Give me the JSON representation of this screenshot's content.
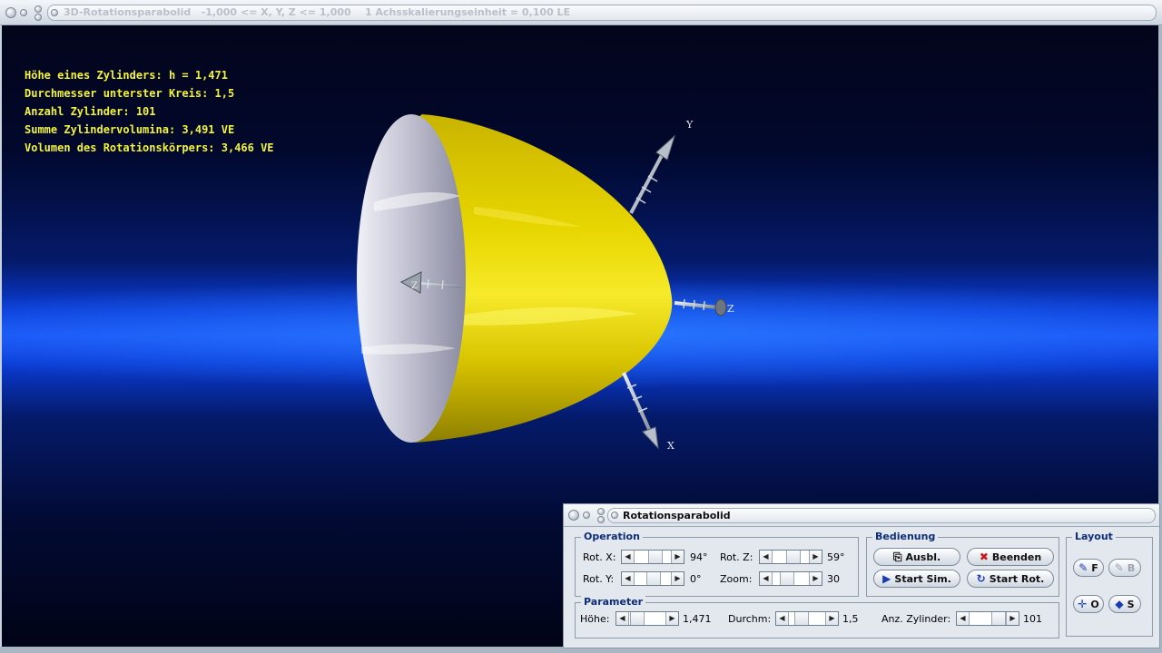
{
  "window": {
    "title": "3D-Rotationsparabolid   -1,000 <= X, Y, Z <= 1,000    1 Achsskalierungseinheit = 0,100 LE"
  },
  "info": {
    "lines": [
      "Höhe eines Zylinders: h = 1,471",
      "Durchmesser unterster Kreis: 1,5",
      "Anzahl Zylinder: 101",
      "Summe Zylindervolumina: 3,491 VE",
      "Volumen des Rotationskörpers: 3,466 VE"
    ]
  },
  "axes": {
    "x": "X",
    "y": "Y",
    "z": "Z",
    "z_back": "Z"
  },
  "colors": {
    "paraboloid": "#e6d200",
    "inner_surface": "#c8c8d8",
    "info_text": "#f2f23a",
    "group_label": "#0d2c7a"
  },
  "dialog": {
    "title": "Rotationsparabolid",
    "operation": {
      "label": "Operation",
      "rot_x_label": "Rot. X:",
      "rot_x_value": "94°",
      "rot_y_label": "Rot. Y:",
      "rot_y_value": "0°",
      "rot_z_label": "Rot. Z:",
      "rot_z_value": "59°",
      "zoom_label": "Zoom:",
      "zoom_value": "30"
    },
    "bedienung": {
      "label": "Bedienung",
      "ausbl": "Ausbl.",
      "beenden": "Beenden",
      "start_sim": "Start Sim.",
      "start_rot": "Start Rot."
    },
    "layout": {
      "label": "Layout",
      "f": "F",
      "b": "B",
      "o": "O",
      "s": "S"
    },
    "parameter": {
      "label": "Parameter",
      "hoehe_label": "Höhe:",
      "hoehe_value": "1,471",
      "durchm_label": "Durchm:",
      "durchm_value": "1,5",
      "anz_label": "Anz. Zylinder:",
      "anz_value": "101"
    }
  }
}
